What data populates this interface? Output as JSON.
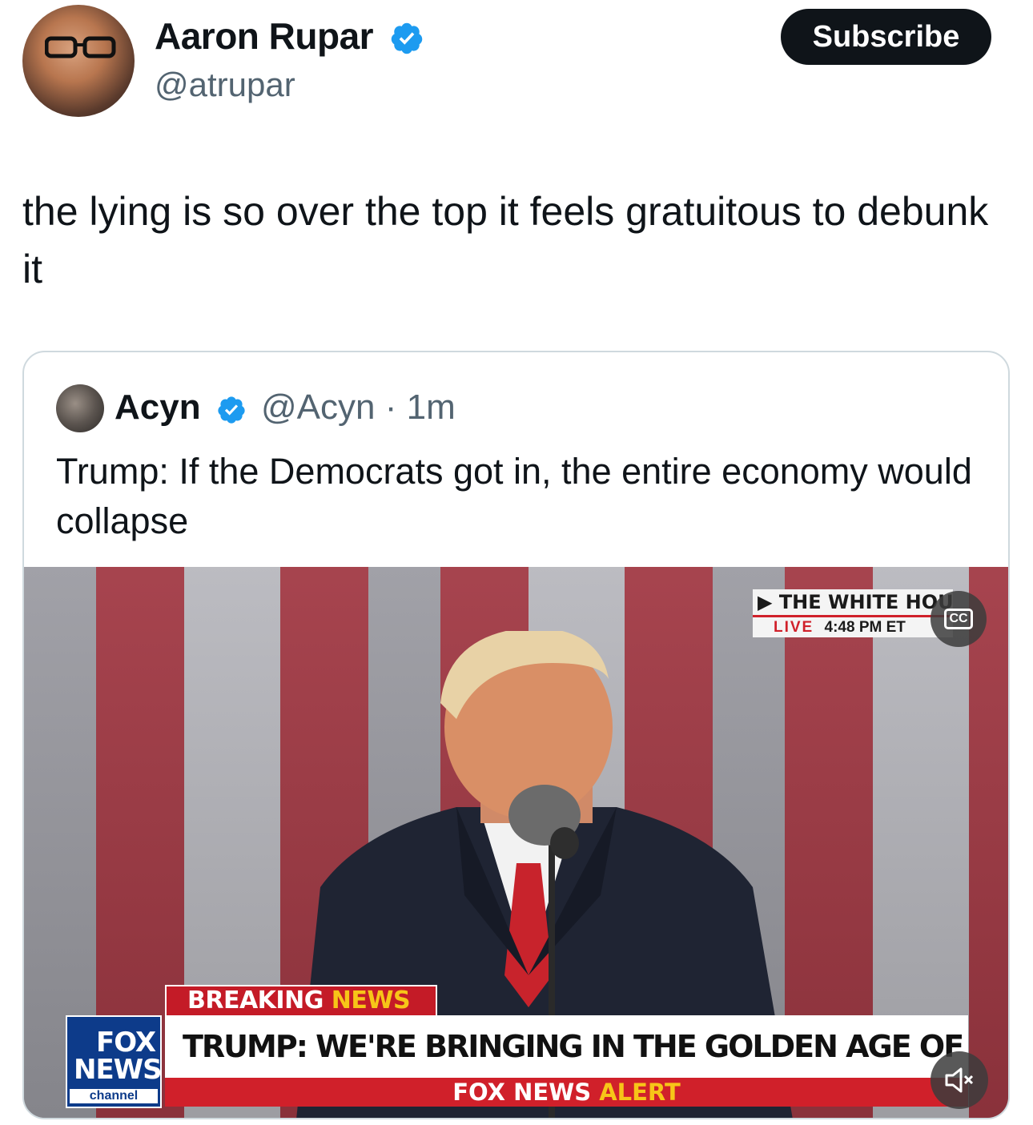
{
  "author": {
    "name": "Aaron Rupar",
    "handle": "@atrupar",
    "verified": true
  },
  "subscribe_label": "Subscribe",
  "tweet_text": "the lying is so over the top it feels gratuitous to debunk it",
  "quoted": {
    "name": "Acyn",
    "handle": "@Acyn",
    "time": "· 1m",
    "verified": true,
    "text": "Trump: If the Democrats got in, the entire economy would collapse"
  },
  "video": {
    "location": "THE WHITE HOUSE",
    "live_label": "LIVE",
    "time_label": "4:48 PM ET",
    "breaking_white": "BREAKING",
    "breaking_yellow": "NEWS",
    "headline": "TRUMP: WE'RE BRINGING IN THE GOLDEN AGE OF AMERICA",
    "logo_line1": "FOX",
    "logo_line2": "NEWS",
    "logo_line3": "channel",
    "alert_white": "FOX NEWS",
    "alert_yellow": "ALERT",
    "cc_label": "CC"
  },
  "colors": {
    "verified_blue": "#1d9bf0",
    "fox_red": "#d0202a",
    "fox_blue": "#0d3b8a",
    "fox_yellow": "#f7c518"
  }
}
